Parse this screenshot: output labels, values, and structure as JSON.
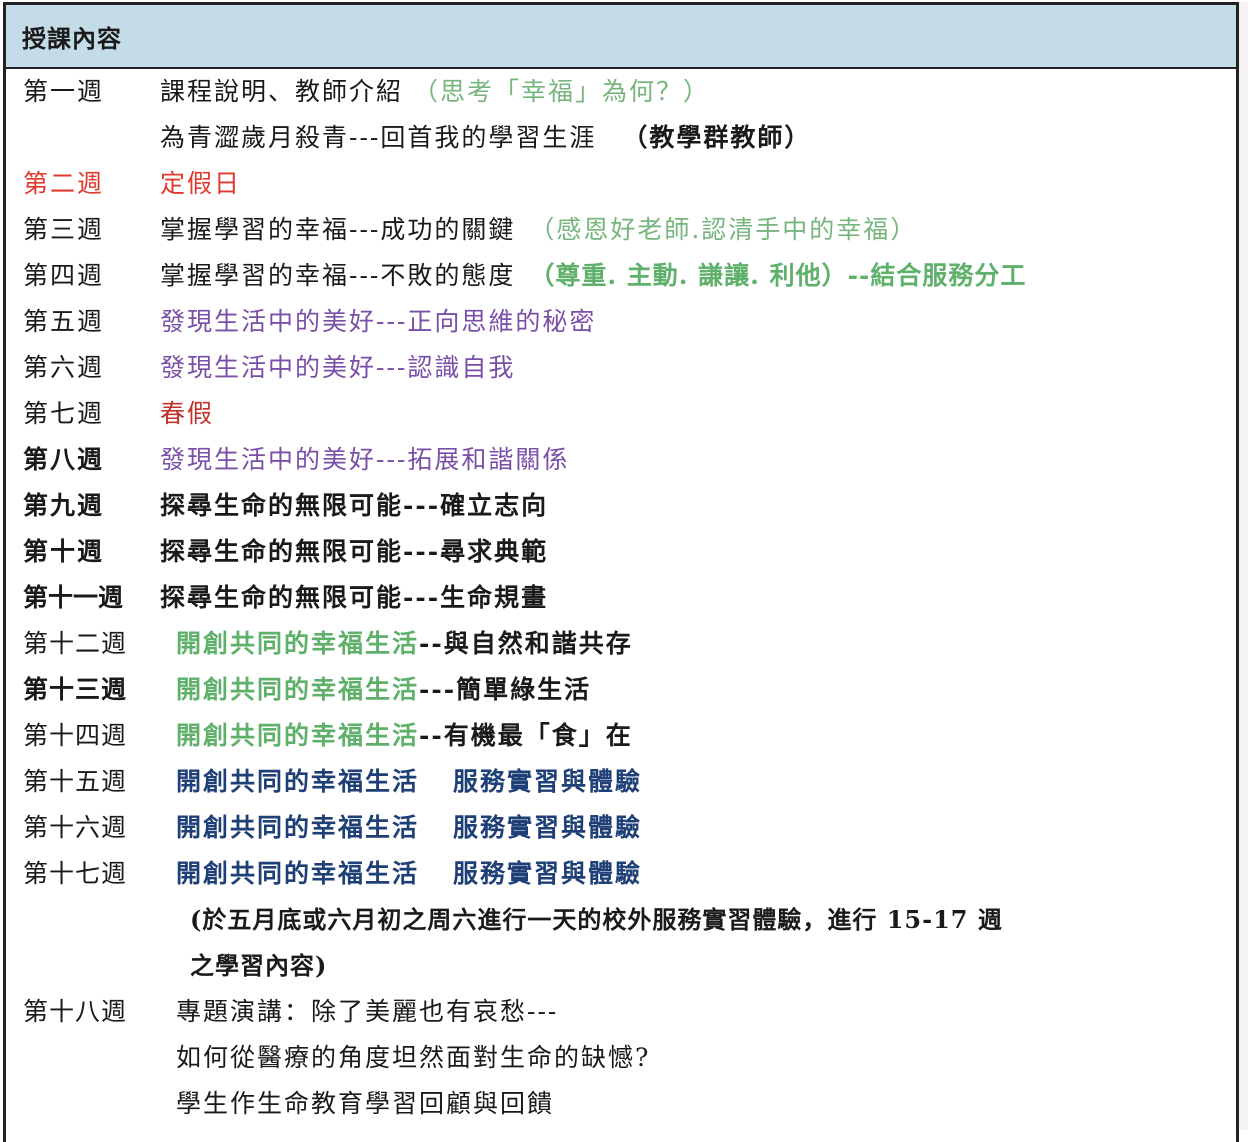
{
  "header": {
    "title": "授課內容"
  },
  "rows": {
    "w1": {
      "week": "第一週",
      "a": "課程說明、教師介紹",
      "b": "（思考「幸福」為何？）"
    },
    "w1b": {
      "a": "為青澀歲月殺青---回首我的學習生涯",
      "b": "（教學群教師）"
    },
    "w2": {
      "week": "第二週",
      "a": "定假日"
    },
    "w3": {
      "week": "第三週",
      "a": "掌握學習的幸福---成功的關鍵",
      "b": "（感恩好老師.認清手中的幸福）"
    },
    "w4": {
      "week": "第四週",
      "a": "掌握學習的幸福---不敗的態度",
      "b": "（尊重. 主動. 謙讓. 利他）--結合服務分工"
    },
    "w5": {
      "week": "第五週",
      "a": "發現生活中的美好---正向思維的秘密"
    },
    "w6": {
      "week": "第六週",
      "a": "發現生活中的美好---認識自我"
    },
    "w7": {
      "week": "第七週",
      "a": "春假"
    },
    "w8": {
      "week": "第八週",
      "a": "發現生活中的美好---拓展和諧關係"
    },
    "w9": {
      "week": "第九週",
      "a": "探尋生命的無限可能---確立志向"
    },
    "w10": {
      "week": "第十週",
      "a": "探尋生命的無限可能---尋求典範"
    },
    "w11": {
      "week": "第十一週",
      "a": "探尋生命的無限可能---生命規畫"
    },
    "w12": {
      "week": "第十二週",
      "a": "開創共同的幸福生活",
      "b": "--與自然和諧共存"
    },
    "w13": {
      "week": "第十三週",
      "a": "開創共同的幸福生活",
      "b": "---簡單綠生活"
    },
    "w14": {
      "week": "第十四週",
      "a": "開創共同的幸福生活",
      "b": "--有機最「食」在"
    },
    "w15": {
      "week": "第十五週",
      "a": "開創共同的幸福生活",
      "b": "服務實習與體驗"
    },
    "w16": {
      "week": "第十六週",
      "a": "開創共同的幸福生活",
      "b": "服務實習與體驗"
    },
    "w17": {
      "week": "第十七週",
      "a": "開創共同的幸福生活",
      "b": "服務實習與體驗"
    },
    "note1": "(於五月底或六月初之周六進行一天的校外服務實習體驗，進行 15-17 週",
    "note2": "之學習內容)",
    "w18": {
      "week": "第十八週",
      "a": "專題演講：除了美麗也有哀愁---"
    },
    "w18b": "如何從醫療的角度坦然面對生命的缺憾?",
    "w18c": "學生作生命教育學習回顧與回饋"
  }
}
